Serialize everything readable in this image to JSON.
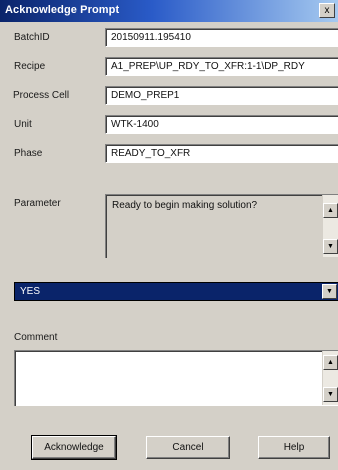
{
  "window": {
    "title": "Acknowledge Prompt",
    "close_glyph": "x"
  },
  "fields": [
    {
      "label": "BatchID",
      "value": "20150911.195410"
    },
    {
      "label": "Recipe",
      "value": "A1_PREP\\UP_RDY_TO_XFR:1-1\\DP_RDY"
    },
    {
      "label": "Process Cell",
      "value": "DEMO_PREP1"
    },
    {
      "label": "Unit",
      "value": "WTK-1400"
    },
    {
      "label": "Phase",
      "value": "READY_TO_XFR"
    }
  ],
  "parameter": {
    "label": "Parameter",
    "value": "Ready to begin making solution?"
  },
  "response": {
    "selected": "YES"
  },
  "comment": {
    "label": "Comment",
    "value": ""
  },
  "buttons": {
    "acknowledge": "Acknowledge",
    "cancel": "Cancel",
    "help": "Help"
  },
  "icons": {
    "up_arrow": "▲",
    "down_arrow": "▼"
  }
}
